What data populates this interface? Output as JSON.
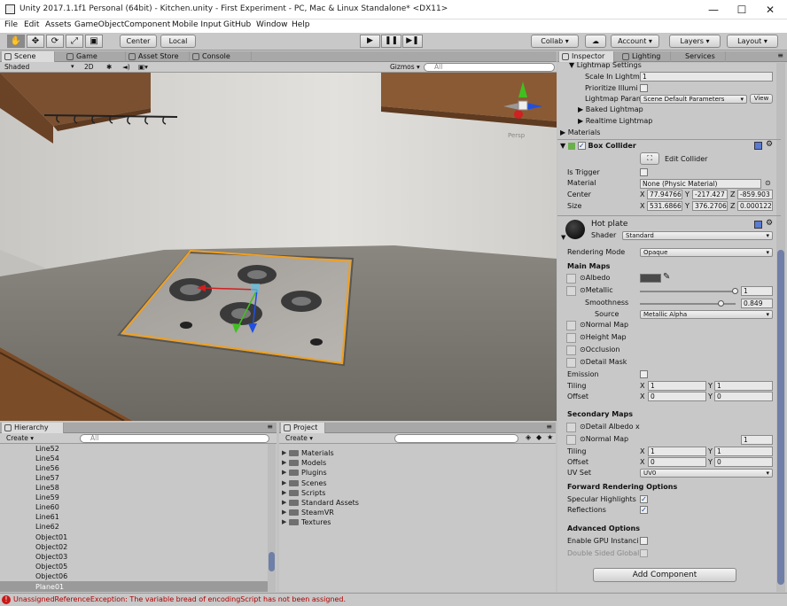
{
  "window": {
    "title": "Unity 2017.1.1f1 Personal (64bit) - Kitchen.unity - First Experiment - PC, Mac & Linux Standalone* <DX11>",
    "minimize": "—",
    "maximize": "☐",
    "close": "✕"
  },
  "menu": [
    "File",
    "Edit",
    "Assets",
    "GameObject",
    "Component",
    "Mobile Input",
    "GitHub",
    "Window",
    "Help"
  ],
  "toolbar": {
    "pivot": "Center",
    "space": "Local",
    "collab": "Collab ▾",
    "account": "Account ▾",
    "layers": "Layers ▾",
    "layout": "Layout ▾"
  },
  "tabs": {
    "scene": "Scene",
    "game": "Game",
    "asset_store": "Asset Store",
    "console": "Console",
    "inspector": "Inspector",
    "lighting": "Lighting",
    "services": "Services",
    "hierarchy": "Hierarchy",
    "project": "Project"
  },
  "scene_bar": {
    "shading": "Shaded",
    "mode_2d": "2D",
    "gizmos": "Gizmos ▾",
    "search_placeholder": "All"
  },
  "scene_gizmo": {
    "label": "Persp"
  },
  "hierarchy": {
    "create": "Create ▾",
    "search_placeholder": "All",
    "items": [
      "Line52",
      "Line54",
      "Line56",
      "Line57",
      "Line58",
      "Line59",
      "Line60",
      "Line61",
      "Line62",
      "Object01",
      "Object02",
      "Object03",
      "Object05",
      "Object06",
      "Plane01"
    ],
    "selected": "Plane01"
  },
  "project": {
    "create": "Create ▾",
    "folders": [
      "Materials",
      "Models",
      "Plugins",
      "Scenes",
      "Scripts",
      "Standard Assets",
      "SteamVR",
      "Textures"
    ]
  },
  "inspector": {
    "lightmap_settings": "Lightmap Settings",
    "scale_in_lightmap_label": "Scale In Lightm",
    "scale_in_lightmap_value": "1",
    "prioritize_label": "Prioritize Illumi",
    "lightmap_params_label": "Lightmap Paran",
    "lightmap_params_value": "Scene Default Parameters",
    "view_button": "View",
    "baked_lightmap": "Baked Lightmap",
    "realtime_lightmap": "Realtime Lightmap",
    "materials": "Materials",
    "box_collider": "Box Collider",
    "edit_collider": "Edit Collider",
    "is_trigger": "Is Trigger",
    "material_label": "Material",
    "material_value": "None (Physic Material)",
    "center_label": "Center",
    "center_x": "77.94766",
    "center_y": "-217.427",
    "center_z": "-859.903",
    "size_label": "Size",
    "size_x": "531.6866",
    "size_y": "376.2706",
    "size_z": "0.000122",
    "axis_x": "X",
    "axis_y": "Y",
    "axis_z": "Z",
    "material_name": "Hot plate",
    "shader_label": "Shader",
    "shader_value": "Standard",
    "rendering_mode_label": "Rendering Mode",
    "rendering_mode_value": "Opaque",
    "main_maps": "Main Maps",
    "albedo": "Albedo",
    "metallic": "Metallic",
    "metallic_value": "1",
    "metallic_level": 1.0,
    "smoothness": "Smoothness",
    "smoothness_value": "0.849",
    "smoothness_level": 0.849,
    "source": "Source",
    "source_value": "Metallic Alpha",
    "normal_map": "Normal Map",
    "height_map": "Height Map",
    "occlusion": "Occlusion",
    "detail_mask": "Detail Mask",
    "emission": "Emission",
    "tiling": "Tiling",
    "offset": "Offset",
    "tiling_x": "1",
    "tiling_y": "1",
    "offset_x": "0",
    "offset_y": "0",
    "secondary_maps": "Secondary Maps",
    "detail_albedo": "Detail Albedo x",
    "sec_normal_map": "Normal Map",
    "sec_normal_value": "1",
    "sec_tiling_x": "1",
    "sec_tiling_y": "1",
    "sec_offset_x": "0",
    "sec_offset_y": "0",
    "uv_set": "UV Set",
    "uv_set_value": "UV0",
    "forward_rendering": "Forward Rendering Options",
    "specular_highlights": "Specular Highlights",
    "reflections": "Reflections",
    "advanced_options": "Advanced Options",
    "gpu_instancing": "Enable GPU Instanci",
    "double_sided": "Double Sided Global",
    "add_component": "Add Component"
  },
  "status": {
    "message": "UnassignedReferenceException: The variable bread of encodingScript has not been assigned.",
    "color": "#b00000"
  }
}
